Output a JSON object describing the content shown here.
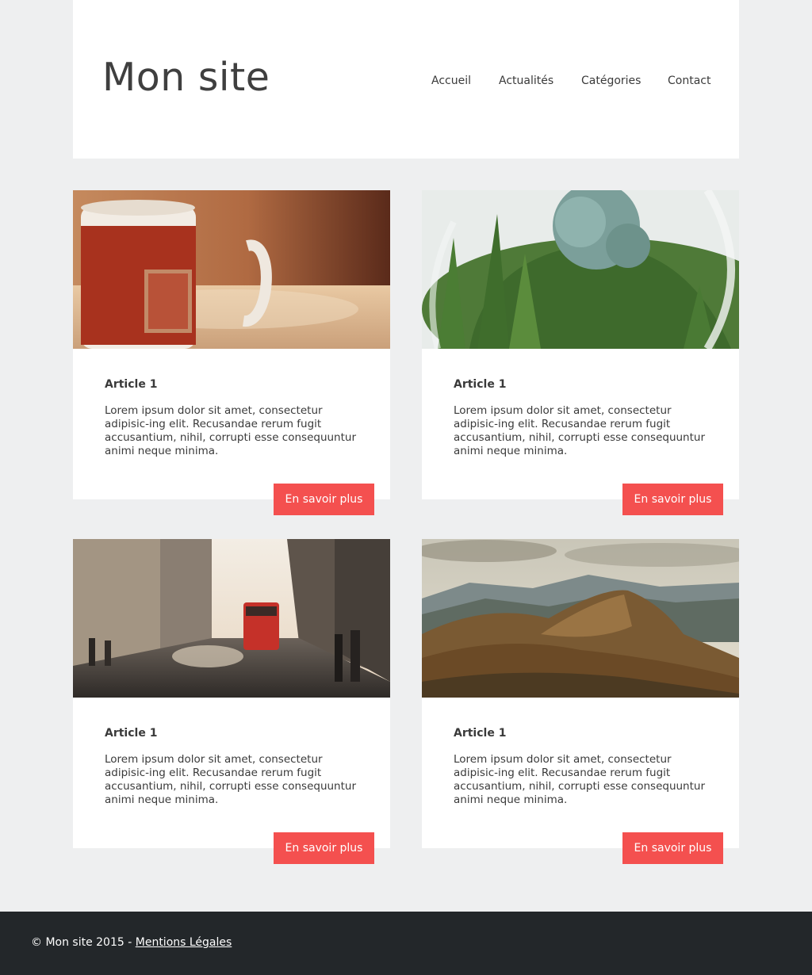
{
  "header": {
    "site_title": "Mon site",
    "nav": [
      "Accueil",
      "Actualités",
      "Catégories",
      "Contact"
    ]
  },
  "articles": [
    {
      "image": "coffee-mug-photo",
      "title": "Article 1",
      "text": "Lorem ipsum dolor sit amet, consectetur adipisic-ing elit. Recusandae rerum fugit accusantium, nihil, corrupti esse consequuntur animi neque minima.",
      "button": "En savoir plus"
    },
    {
      "image": "succulent-terrarium-photo",
      "title": "Article 1",
      "text": "Lorem ipsum dolor sit amet, consectetur adipisic-ing elit. Recusandae rerum fugit accusantium, nihil, corrupti esse consequuntur animi neque minima.",
      "button": "En savoir plus"
    },
    {
      "image": "city-street-photo",
      "title": "Article 1",
      "text": "Lorem ipsum dolor sit amet, consectetur adipisic-ing elit. Recusandae rerum fugit accusantium, nihil, corrupti esse consequuntur animi neque minima.",
      "button": "En savoir plus"
    },
    {
      "image": "mountain-landscape-photo",
      "title": "Article 1",
      "text": "Lorem ipsum dolor sit amet, consectetur adipisic-ing elit. Recusandae rerum fugit accusantium, nihil, corrupti esse consequuntur animi neque minima.",
      "button": "En savoir plus"
    }
  ],
  "footer": {
    "copyright": "© Mon site 2015 - ",
    "legal_link": "Mentions Légales"
  },
  "colors": {
    "accent": "#f4504f",
    "background": "#eeeff0",
    "footer": "#23272a"
  }
}
